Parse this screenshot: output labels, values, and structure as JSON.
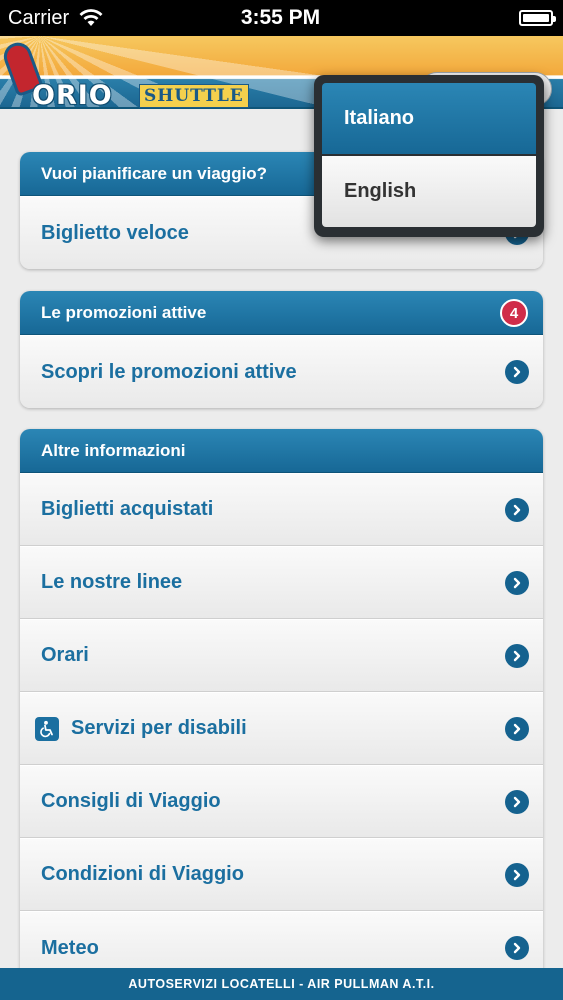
{
  "status_bar": {
    "carrier": "Carrier",
    "time": "3:55 PM"
  },
  "header": {
    "logo_text": "ORIO",
    "logo_sub": "SHUTTLE"
  },
  "sections": {
    "plan": {
      "title": "Vuoi pianificare un viaggio?",
      "items": [
        {
          "label": "Biglietto veloce"
        }
      ]
    },
    "promotions": {
      "title": "Le promozioni attive",
      "badge": "4",
      "items": [
        {
          "label": "Scopri le promozioni attive"
        }
      ]
    },
    "info": {
      "title": "Altre informazioni",
      "items": [
        {
          "label": "Biglietti acquistati"
        },
        {
          "label": "Le nostre linee"
        },
        {
          "label": "Orari"
        },
        {
          "label": "Servizi per disabili"
        },
        {
          "label": "Consigli di Viaggio"
        },
        {
          "label": "Condizioni di Viaggio"
        },
        {
          "label": "Meteo"
        }
      ]
    }
  },
  "language_menu": {
    "options": [
      "Italiano",
      "English"
    ],
    "selected": "Italiano"
  },
  "footer": {
    "text": "AUTOSERVIZI LOCATELLI - AIR PULLMAN A.T.I."
  },
  "colors": {
    "primary": "#1b6fa0",
    "header_blue": "#176896",
    "badge": "#d02c49",
    "footer": "#15648f"
  }
}
